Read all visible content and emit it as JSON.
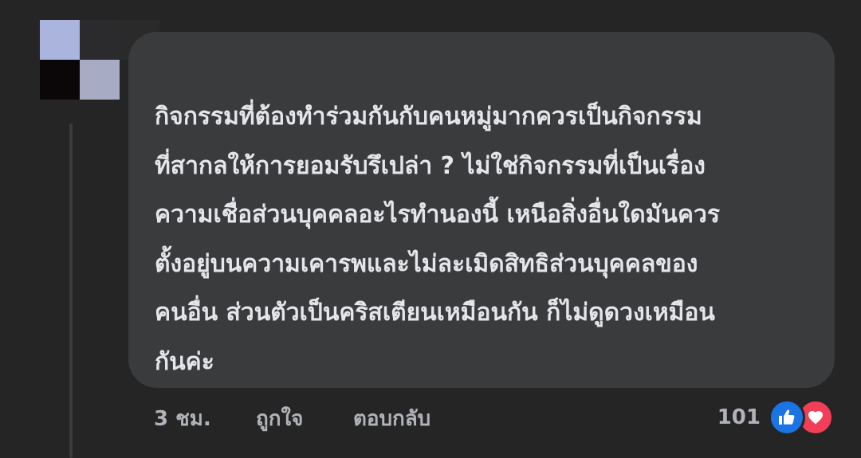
{
  "comment": {
    "text": "กิจกรรมที่ต้องทำร่วมกันกับคนหมู่มากควรเป็นกิจกรรม\nที่สากลให้การยอมรับรึเปล่า ? ไม่ใช่กิจกรรมที่เป็นเรื่อง\nความเชื่อส่วนบุคคลอะไรทำนองนี้ เหนือสิ่งอื่นใดมันควร\nตั้งอยู่บนความเคารพและไม่ละเมิดสิทธิส่วนบุคคลของ\nคนอื่น ส่วนตัวเป็นคริสเตียนเหมือนกัน ก็ไม่ดูดวงเหมือน\nกันค่ะ",
    "time": "3 ชม.",
    "like_label": "ถูกใจ",
    "reply_label": "ตอบกลับ",
    "reaction_count": "101",
    "reaction_icons": [
      "like-icon",
      "love-icon"
    ]
  },
  "colors": {
    "background": "#252526",
    "bubble": "#3a3b3c",
    "text": "#e4e6eb",
    "secondary_text": "#b0b3b8",
    "like_blue": "#1b74e4",
    "love_red": "#f33e58"
  }
}
